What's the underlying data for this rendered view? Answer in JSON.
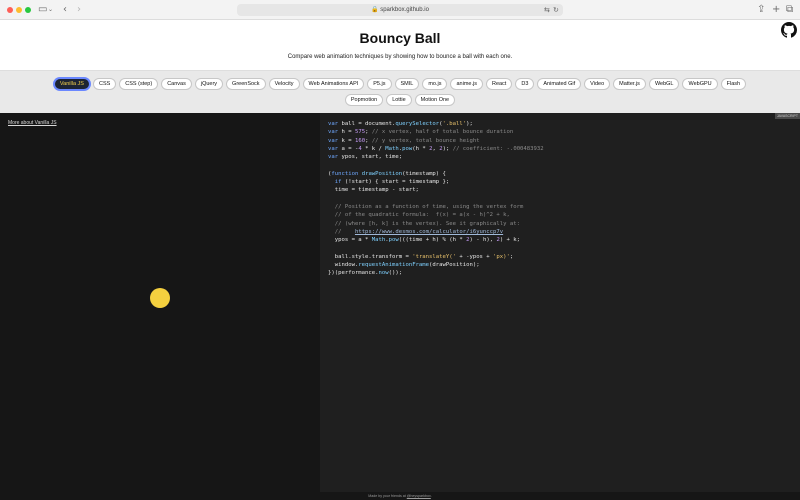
{
  "browser": {
    "url": "sparkbox.github.io",
    "icons": {
      "sidebar": "sidebar-icon",
      "back": "chevron-left-icon",
      "forward": "chevron-right-icon",
      "lock": "lock-icon",
      "translate": "translate-icon",
      "reload": "reload-icon",
      "share": "share-icon",
      "new_tab": "plus-icon",
      "tabs": "tabs-overview-icon"
    }
  },
  "header": {
    "title": "Bouncy Ball",
    "subtitle": "Compare web animation techniques by showing how to bounce a ball with each one.",
    "github_icon": "github-icon"
  },
  "tabs": {
    "row1": [
      "Vanilla JS",
      "CSS",
      "CSS (step)",
      "Canvas",
      "jQuery",
      "GreenSock",
      "Velocity",
      "Web Animations API",
      "P5.js",
      "SMIL",
      "mo.js",
      "anime.js",
      "React",
      "D3",
      "Animated Gif",
      "Video",
      "Matter.js",
      "WebGL",
      "WebGPU",
      "Flash"
    ],
    "row2": [
      "Popmotion",
      "Lottie",
      "Motion One"
    ],
    "active": "Vanilla JS"
  },
  "demo": {
    "more_link": "More about Vanilla JS",
    "ball_color": "#f4d03f"
  },
  "code": {
    "tag": "JAVASCRIPT",
    "lines": [
      "var ball = document.querySelector('.ball');",
      "var h = 575; // x vertex, half of total bounce duration",
      "var k = 160; // y vertex, total bounce height",
      "var a = -4 * k / Math.pow(h * 2, 2); // coefficient: -.000483932",
      "var ypos, start, time;",
      "",
      "(function drawPosition(timestamp) {",
      "  if (!start) { start = timestamp };",
      "  time = timestamp - start;",
      "",
      "  // Position as a function of time, using the vertex form",
      "  // of the quadratic formula:  f(x) = a(x - h)^2 + k,",
      "  // (where [h, k] is the vertex). See it graphically at:",
      "  //    https://www.desmos.com/calculator/i6yunccp7v",
      "  ypos = a * Math.pow(((time + h) % (h * 2) - h), 2) + k;",
      "",
      "  ball.style.transform = 'translateY(' + -ypos + 'px)';",
      "  window.requestAnimationFrame(drawPosition);",
      "})(performance.now());"
    ]
  },
  "footer": {
    "text": "Made by your friends at",
    "link": "@heysparkbox"
  }
}
